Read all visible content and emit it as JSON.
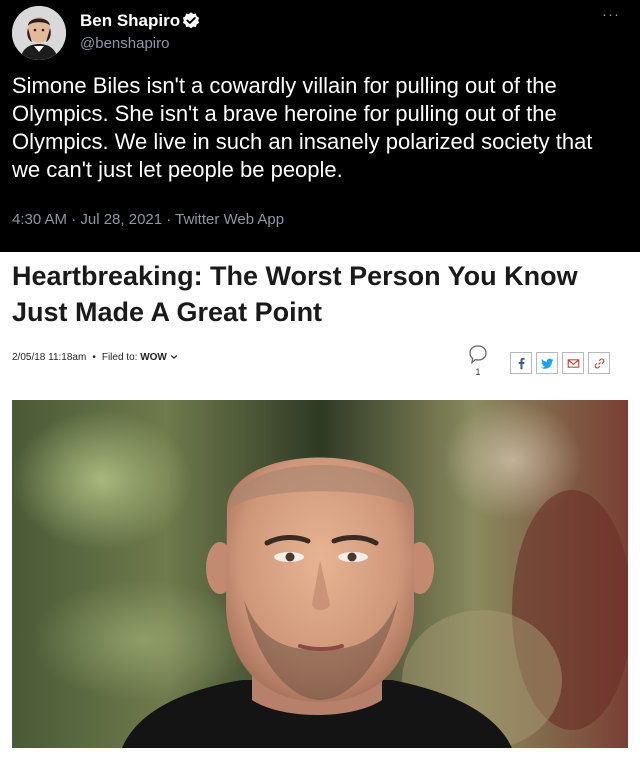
{
  "tweet": {
    "display_name": "Ben Shapiro",
    "handle": "@benshapiro",
    "more_label": "···",
    "text": "Simone Biles isn't a cowardly villain for pulling out of the Olympics. She isn't a brave heroine for pulling out of the Olympics. We live in such an insanely polarized society that we can't just let people be people.",
    "meta": "4:30 AM · Jul 28, 2021 · Twitter Web App",
    "verified_color": "#ffffff"
  },
  "article": {
    "title": "Heartbreaking: The Worst Person You Know Just Made A Great Point",
    "date": "2/05/18 11:18am",
    "dot": "•",
    "filed_prefix": "Filed to:",
    "filed_value": "WOW",
    "comment_count": "1",
    "share_icons": [
      "facebook-icon",
      "twitter-icon",
      "email-icon",
      "link-icon"
    ],
    "accent": "#333333"
  },
  "icons": {
    "verified": "verified-badge-icon",
    "chevron": "chevron-down-icon",
    "comment": "comment-icon"
  }
}
